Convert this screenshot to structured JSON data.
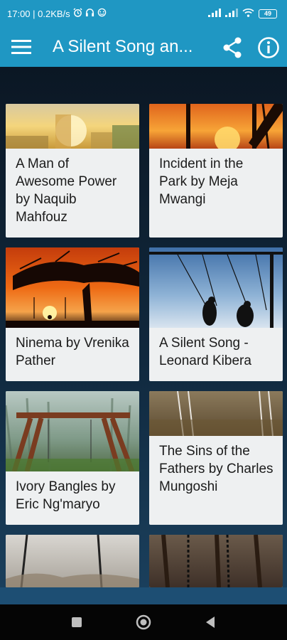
{
  "status_bar": {
    "time_speed": "17:00 | 0.2KB/s",
    "battery": "49"
  },
  "app_bar": {
    "title": "A Silent Song an..."
  },
  "stories": [
    {
      "title": "A Man of Awesome Power by Naquib Mahfouz"
    },
    {
      "title": "Incident in the Park by Meja Mwangi"
    },
    {
      "title": "Ninema by Vrenika Pather"
    },
    {
      "title": "A Silent Song - Leonard Kibera"
    },
    {
      "title": "Ivory Bangles by Eric Ng'maryo"
    },
    {
      "title": "The Sins of the Fathers by Charles Mungoshi"
    },
    {
      "title": ""
    },
    {
      "title": ""
    }
  ],
  "colors": {
    "primary": "#1f97c3",
    "card_background": "#eef0f1",
    "nav_bar": "#050505"
  }
}
